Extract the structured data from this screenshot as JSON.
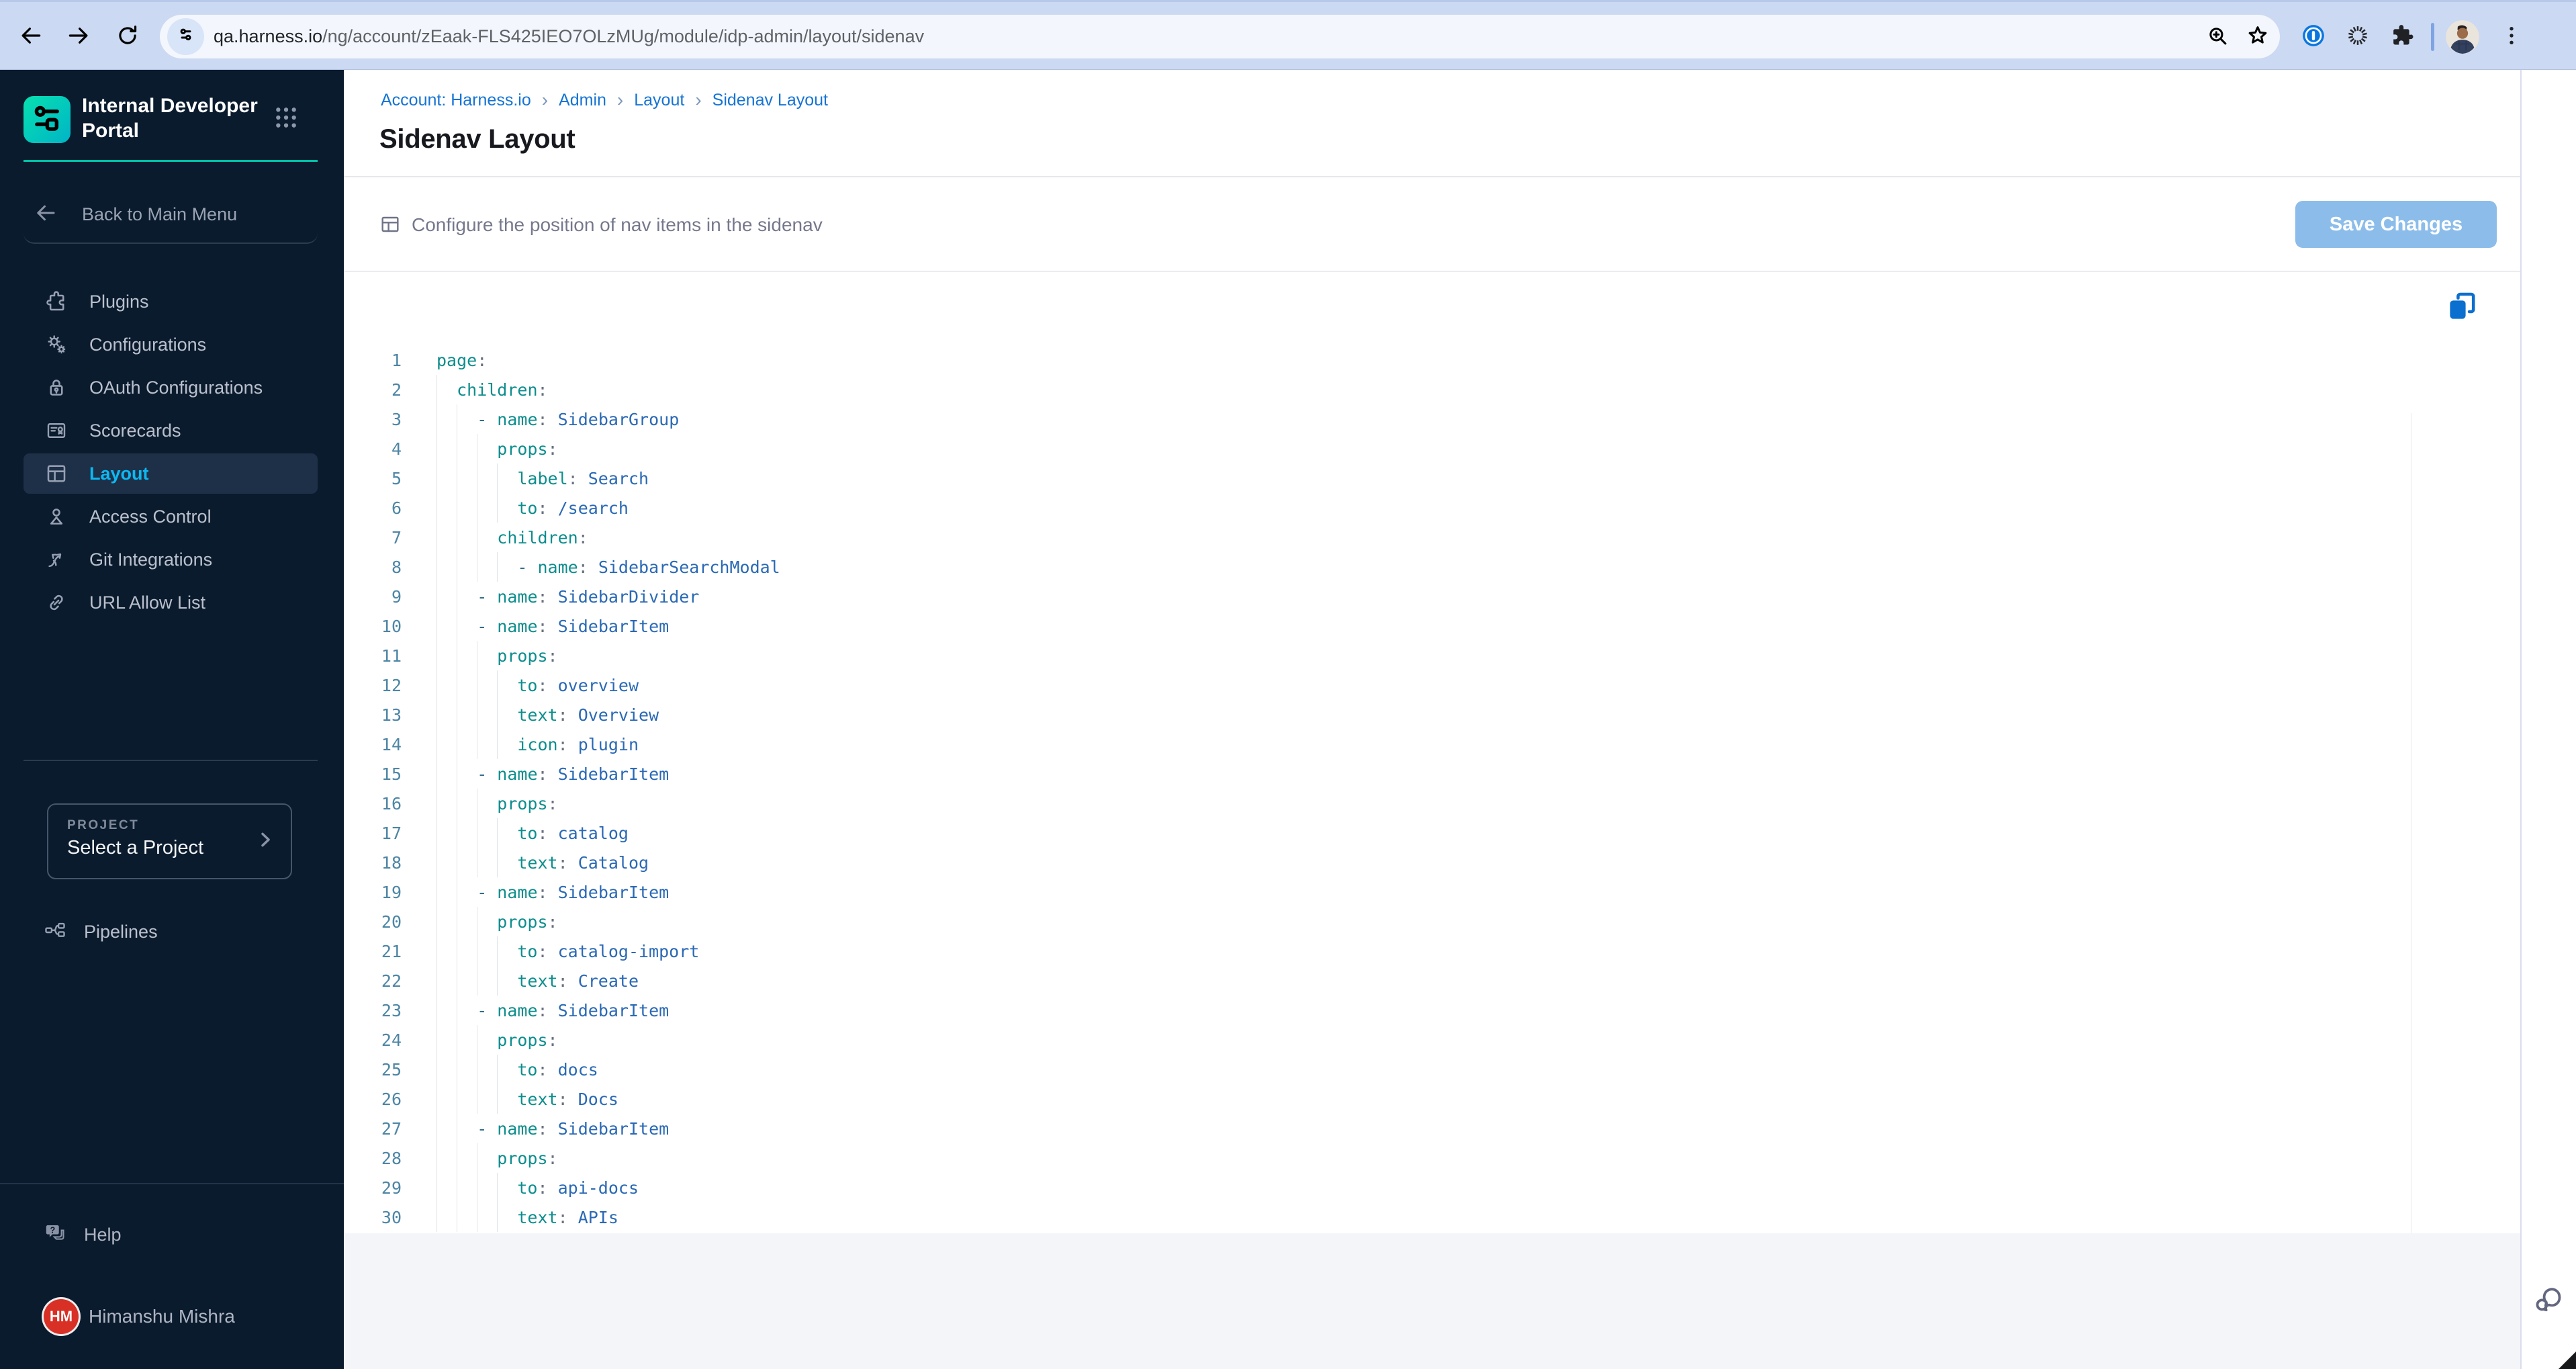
{
  "browser": {
    "url": {
      "host": "qa.harness.io",
      "path": "/ng/account/zEaak-FLS425IEO7OLzMUg/module/idp-admin/layout/sidenav"
    }
  },
  "sidebar": {
    "logo_title": "Internal Developer Portal",
    "back_label": "Back to Main Menu",
    "nav": [
      {
        "icon": "plugins-icon",
        "label": "Plugins"
      },
      {
        "icon": "configurations-icon",
        "label": "Configurations"
      },
      {
        "icon": "oauth-configurations-icon",
        "label": "OAuth Configurations"
      },
      {
        "icon": "scorecards-icon",
        "label": "Scorecards"
      },
      {
        "icon": "layout-icon",
        "label": "Layout",
        "selected": true
      },
      {
        "icon": "access-control-icon",
        "label": "Access Control"
      },
      {
        "icon": "git-integrations-icon",
        "label": "Git Integrations"
      },
      {
        "icon": "url-allow-list-icon",
        "label": "URL Allow List"
      }
    ],
    "project": {
      "label": "PROJECT",
      "value": "Select a Project"
    },
    "pipelines_label": "Pipelines",
    "help_label": "Help",
    "user": {
      "initials": "HM",
      "name": "Himanshu Mishra"
    }
  },
  "main": {
    "breadcrumb": [
      "Account: Harness.io",
      "Admin",
      "Layout",
      "Sidenav Layout"
    ],
    "breadcrumb_separator": "›",
    "title": "Sidenav Layout",
    "toolbar": {
      "description": "Configure the position of nav items in the sidenav",
      "save_label": "Save Changes"
    },
    "editor": {
      "lines": [
        {
          "n": 1,
          "ind": 0,
          "seg": [
            [
              "k",
              "page"
            ],
            [
              "p",
              ":"
            ]
          ]
        },
        {
          "n": 2,
          "ind": 2,
          "seg": [
            [
              "k",
              "children"
            ],
            [
              "p",
              ":"
            ]
          ]
        },
        {
          "n": 3,
          "ind": 4,
          "seg": [
            [
              "d",
              "- "
            ],
            [
              "k",
              "name"
            ],
            [
              "p",
              ": "
            ],
            [
              "v",
              "SidebarGroup"
            ]
          ]
        },
        {
          "n": 4,
          "ind": 6,
          "seg": [
            [
              "k",
              "props"
            ],
            [
              "p",
              ":"
            ]
          ]
        },
        {
          "n": 5,
          "ind": 8,
          "seg": [
            [
              "k",
              "label"
            ],
            [
              "p",
              ": "
            ],
            [
              "v",
              "Search"
            ]
          ]
        },
        {
          "n": 6,
          "ind": 8,
          "seg": [
            [
              "k",
              "to"
            ],
            [
              "p",
              ": "
            ],
            [
              "v",
              "/search"
            ]
          ]
        },
        {
          "n": 7,
          "ind": 6,
          "seg": [
            [
              "k",
              "children"
            ],
            [
              "p",
              ":"
            ]
          ]
        },
        {
          "n": 8,
          "ind": 8,
          "seg": [
            [
              "d",
              "- "
            ],
            [
              "k",
              "name"
            ],
            [
              "p",
              ": "
            ],
            [
              "v",
              "SidebarSearchModal"
            ]
          ]
        },
        {
          "n": 9,
          "ind": 4,
          "seg": [
            [
              "d",
              "- "
            ],
            [
              "k",
              "name"
            ],
            [
              "p",
              ": "
            ],
            [
              "v",
              "SidebarDivider"
            ]
          ]
        },
        {
          "n": 10,
          "ind": 4,
          "seg": [
            [
              "d",
              "- "
            ],
            [
              "k",
              "name"
            ],
            [
              "p",
              ": "
            ],
            [
              "v",
              "SidebarItem"
            ]
          ]
        },
        {
          "n": 11,
          "ind": 6,
          "seg": [
            [
              "k",
              "props"
            ],
            [
              "p",
              ":"
            ]
          ]
        },
        {
          "n": 12,
          "ind": 8,
          "seg": [
            [
              "k",
              "to"
            ],
            [
              "p",
              ": "
            ],
            [
              "v",
              "overview"
            ]
          ]
        },
        {
          "n": 13,
          "ind": 8,
          "seg": [
            [
              "k",
              "text"
            ],
            [
              "p",
              ": "
            ],
            [
              "v",
              "Overview"
            ]
          ]
        },
        {
          "n": 14,
          "ind": 8,
          "seg": [
            [
              "k",
              "icon"
            ],
            [
              "p",
              ": "
            ],
            [
              "v",
              "plugin"
            ]
          ]
        },
        {
          "n": 15,
          "ind": 4,
          "seg": [
            [
              "d",
              "- "
            ],
            [
              "k",
              "name"
            ],
            [
              "p",
              ": "
            ],
            [
              "v",
              "SidebarItem"
            ]
          ]
        },
        {
          "n": 16,
          "ind": 6,
          "seg": [
            [
              "k",
              "props"
            ],
            [
              "p",
              ":"
            ]
          ]
        },
        {
          "n": 17,
          "ind": 8,
          "seg": [
            [
              "k",
              "to"
            ],
            [
              "p",
              ": "
            ],
            [
              "v",
              "catalog"
            ]
          ]
        },
        {
          "n": 18,
          "ind": 8,
          "seg": [
            [
              "k",
              "text"
            ],
            [
              "p",
              ": "
            ],
            [
              "v",
              "Catalog"
            ]
          ]
        },
        {
          "n": 19,
          "ind": 4,
          "seg": [
            [
              "d",
              "- "
            ],
            [
              "k",
              "name"
            ],
            [
              "p",
              ": "
            ],
            [
              "v",
              "SidebarItem"
            ]
          ]
        },
        {
          "n": 20,
          "ind": 6,
          "seg": [
            [
              "k",
              "props"
            ],
            [
              "p",
              ":"
            ]
          ]
        },
        {
          "n": 21,
          "ind": 8,
          "seg": [
            [
              "k",
              "to"
            ],
            [
              "p",
              ": "
            ],
            [
              "v",
              "catalog-import"
            ]
          ]
        },
        {
          "n": 22,
          "ind": 8,
          "seg": [
            [
              "k",
              "text"
            ],
            [
              "p",
              ": "
            ],
            [
              "v",
              "Create"
            ]
          ]
        },
        {
          "n": 23,
          "ind": 4,
          "seg": [
            [
              "d",
              "- "
            ],
            [
              "k",
              "name"
            ],
            [
              "p",
              ": "
            ],
            [
              "v",
              "SidebarItem"
            ]
          ]
        },
        {
          "n": 24,
          "ind": 6,
          "seg": [
            [
              "k",
              "props"
            ],
            [
              "p",
              ":"
            ]
          ]
        },
        {
          "n": 25,
          "ind": 8,
          "seg": [
            [
              "k",
              "to"
            ],
            [
              "p",
              ": "
            ],
            [
              "v",
              "docs"
            ]
          ]
        },
        {
          "n": 26,
          "ind": 8,
          "seg": [
            [
              "k",
              "text"
            ],
            [
              "p",
              ": "
            ],
            [
              "v",
              "Docs"
            ]
          ]
        },
        {
          "n": 27,
          "ind": 4,
          "seg": [
            [
              "d",
              "- "
            ],
            [
              "k",
              "name"
            ],
            [
              "p",
              ": "
            ],
            [
              "v",
              "SidebarItem"
            ]
          ]
        },
        {
          "n": 28,
          "ind": 6,
          "seg": [
            [
              "k",
              "props"
            ],
            [
              "p",
              ":"
            ]
          ]
        },
        {
          "n": 29,
          "ind": 8,
          "seg": [
            [
              "k",
              "to"
            ],
            [
              "p",
              ": "
            ],
            [
              "v",
              "api-docs"
            ]
          ]
        },
        {
          "n": 30,
          "ind": 8,
          "seg": [
            [
              "k",
              "text"
            ],
            [
              "p",
              ": "
            ],
            [
              "v",
              "APIs"
            ]
          ]
        }
      ]
    }
  },
  "colors": {
    "accent_blue": "#1574d4",
    "sidebar_bg": "#0b1b2e",
    "teal_accent": "#00c2a8",
    "selected_nav": "#0db8f2",
    "save_disabled": "#8cbdea",
    "yaml_key": "#0d8d8d",
    "yaml_value": "#2a69b5",
    "avatar_red": "#d93025"
  }
}
